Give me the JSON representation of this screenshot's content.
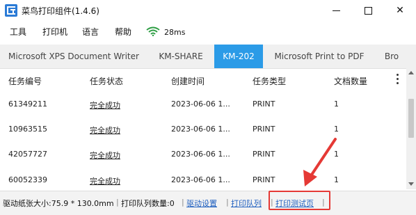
{
  "window": {
    "title": "菜鸟打印组件(1.4.6)",
    "controls": {
      "minimize": "—",
      "maximize": "☐",
      "close": "✕"
    }
  },
  "menu": {
    "items": [
      "工具",
      "打印机",
      "语言",
      "帮助"
    ],
    "latency": "28ms"
  },
  "tabs": [
    {
      "label": "Microsoft XPS Document Writer",
      "active": false
    },
    {
      "label": "KM-SHARE",
      "active": false
    },
    {
      "label": "KM-202",
      "active": true
    },
    {
      "label": "Microsoft Print to PDF",
      "active": false
    },
    {
      "label": "Bro",
      "active": false
    }
  ],
  "table": {
    "columns": [
      "任务编号",
      "任务状态",
      "创建时间",
      "任务类型",
      "文档数量"
    ],
    "rows": [
      {
        "id": "61349211",
        "status": "完全成功",
        "created": "2023-06-06 1...",
        "type": "PRINT",
        "count": "1"
      },
      {
        "id": "10963515",
        "status": "完全成功",
        "created": "2023-06-06 1...",
        "type": "PRINT",
        "count": "1"
      },
      {
        "id": "42057727",
        "status": "完全成功",
        "created": "2023-06-06 1...",
        "type": "PRINT",
        "count": "1"
      },
      {
        "id": "60052339",
        "status": "完全成功",
        "created": "2023-06-06 1...",
        "type": "PRINT",
        "count": "1"
      }
    ]
  },
  "statusbar": {
    "paper_size": "驱动纸张大小:75.9 * 130.0mm",
    "queue_count": "打印队列数量:0",
    "driver_settings": "驱动设置",
    "print_queue": "打印队列",
    "print_test": "打印测试页",
    "separator": "|"
  },
  "colors": {
    "accent_tab": "#2b9be7",
    "link": "#1f5fbf",
    "annotation": "#e53935",
    "wifi": "#2e9e44"
  }
}
